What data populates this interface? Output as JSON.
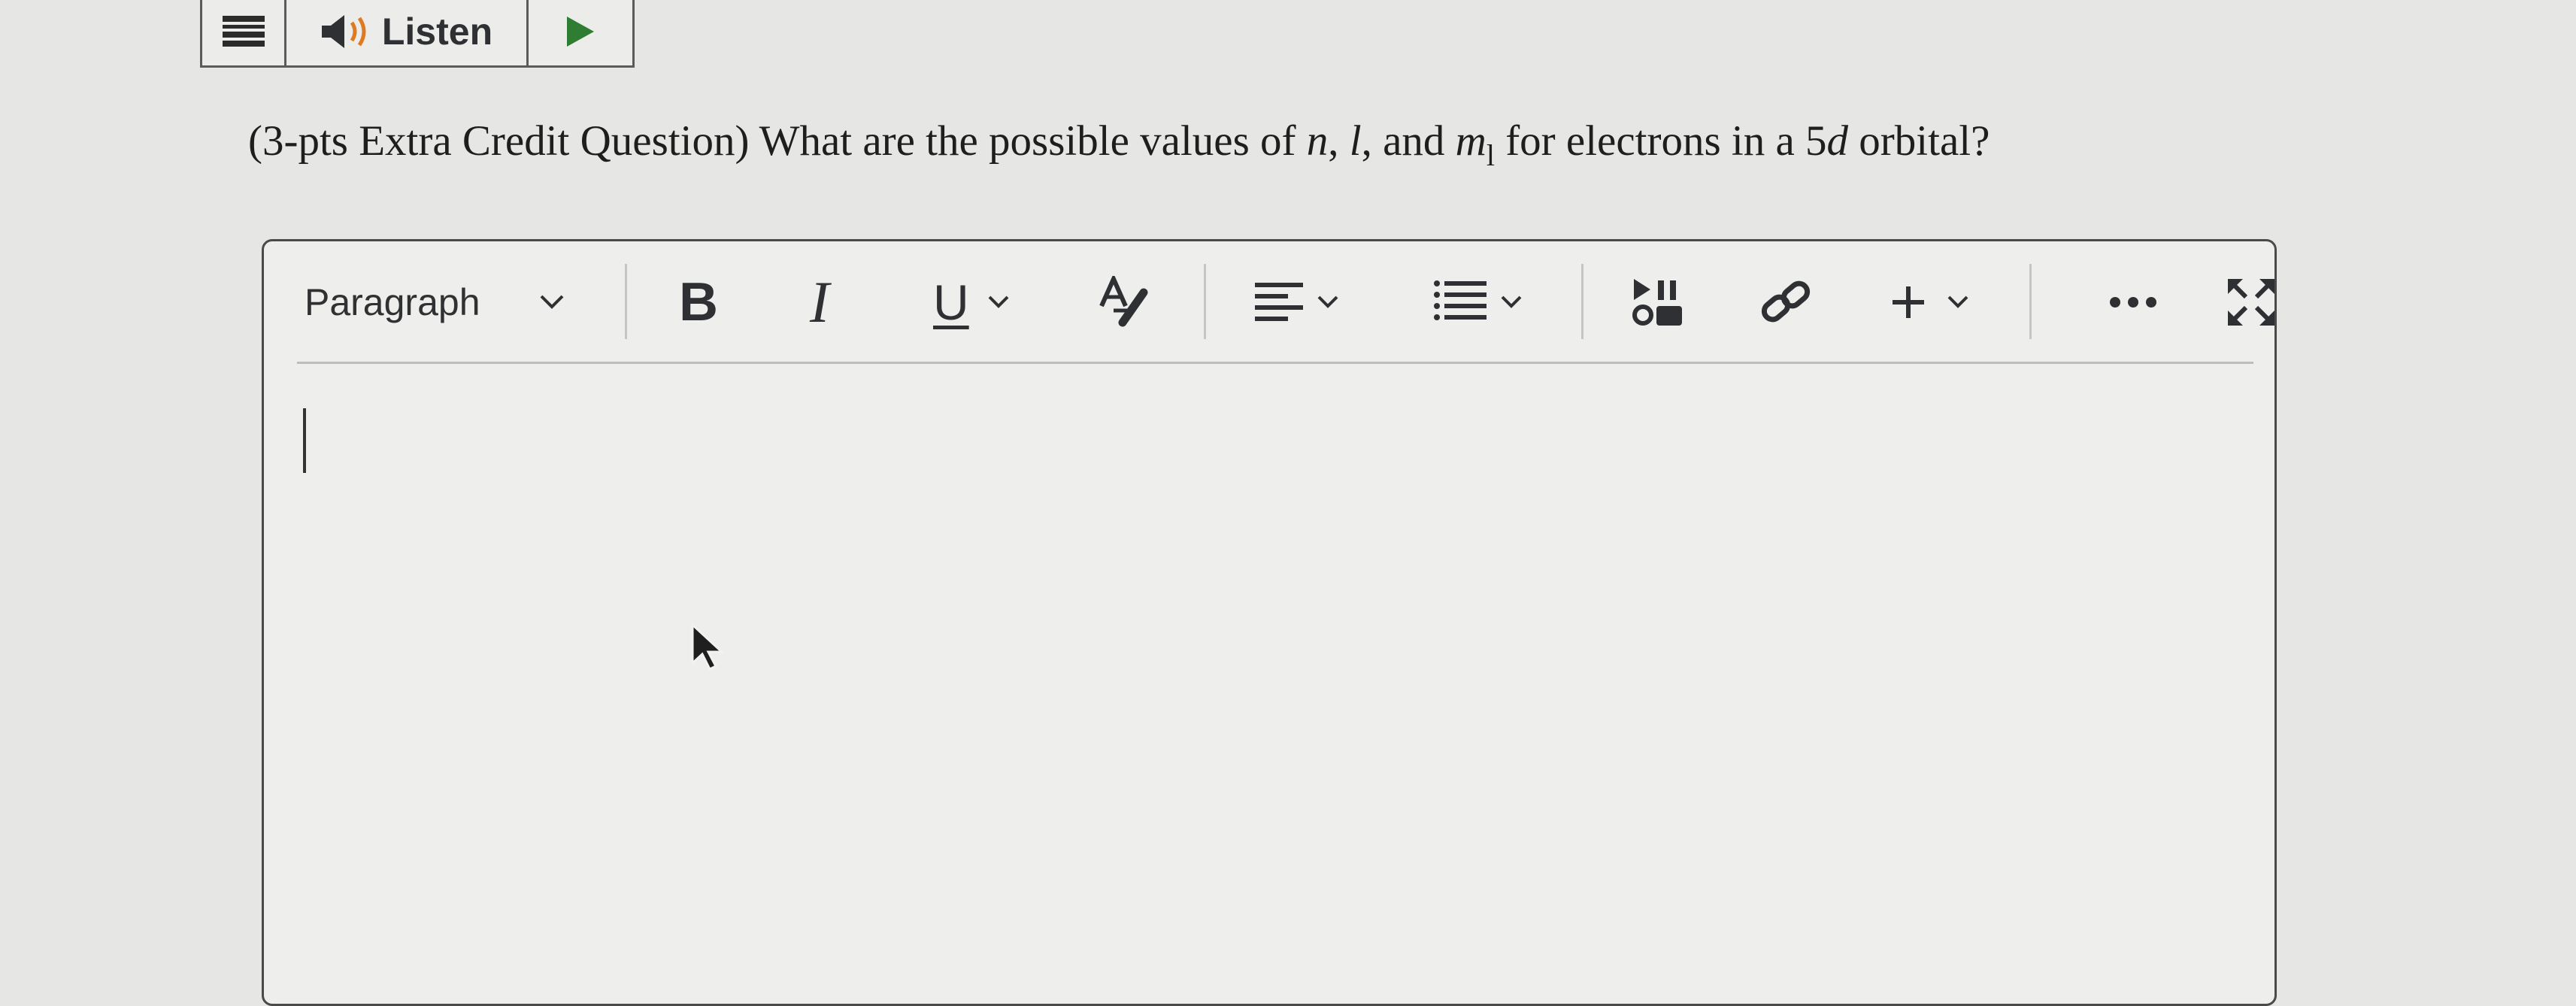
{
  "listen_toolbar": {
    "menu_icon": "hamburger-menu-icon",
    "speaker_icon": "speaker-icon",
    "listen_label": "Listen",
    "play_icon": "play-icon",
    "accent_color": "#2e7d32"
  },
  "question": {
    "prefix": "(3-pts Extra Credit Question) What are the possible values of ",
    "var_n": "n",
    "sep1": ", ",
    "var_l": "l",
    "sep2": ", and ",
    "var_m": "m",
    "sub_m": "l",
    "middle": " for electrons in a 5",
    "var_d": "d",
    "suffix": " orbital?"
  },
  "editor_toolbar": {
    "block_format": "Paragraph",
    "bold_label": "B",
    "italic_label": "I",
    "underline_label": "U",
    "icons": [
      "chevron-down-icon",
      "bold-icon",
      "italic-icon",
      "underline-icon",
      "text-color-icon",
      "align-icon",
      "list-icon",
      "media-icon",
      "link-icon",
      "plus-icon",
      "more-icon",
      "fullscreen-icon"
    ]
  }
}
